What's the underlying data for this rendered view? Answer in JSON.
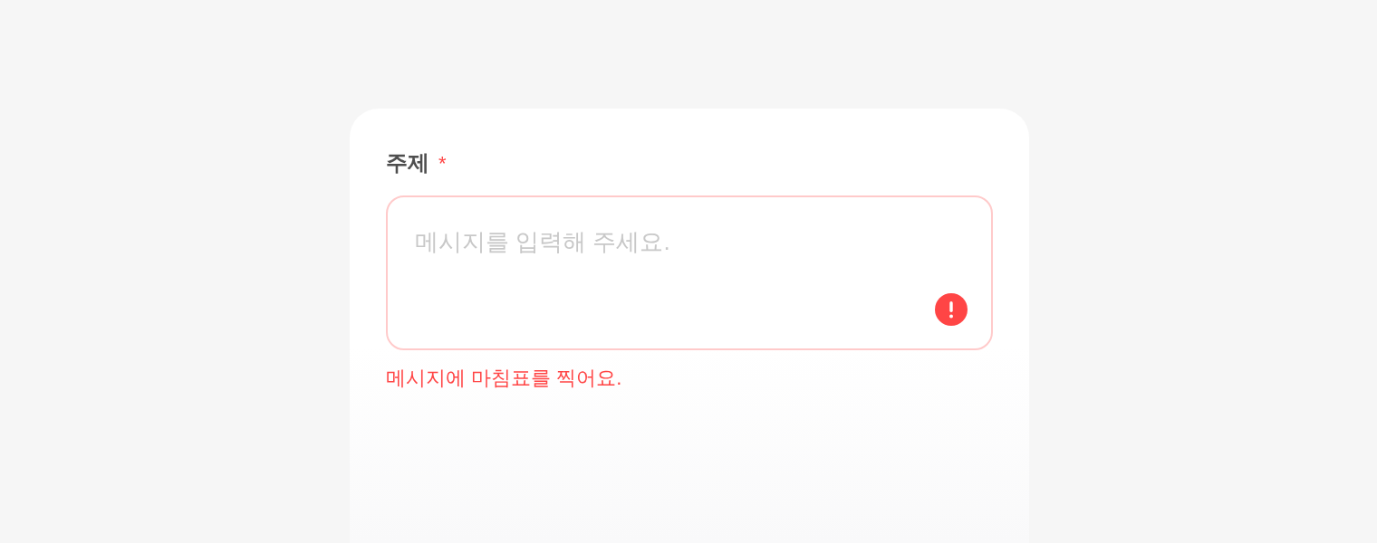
{
  "field": {
    "label": "주제",
    "required_mark": "*",
    "placeholder": "메시지를 입력해 주세요.",
    "error": true,
    "error_message": "메시지에 마침표를 찍어요."
  }
}
